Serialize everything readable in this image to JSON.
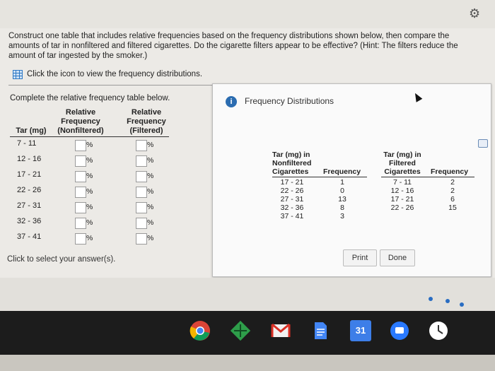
{
  "question": {
    "text": "Construct one table that includes relative frequencies based on the frequency distributions shown below, then compare the amounts of tar in nonfiltered and filtered cigarettes. Do the cigarette filters appear to be effective? (Hint: The filters reduce the amount of tar ingested by the smoker.)",
    "icon_text": "Click the icon to view the frequency distributions."
  },
  "left_table": {
    "instruction": "Complete the relative frequency table below.",
    "col_tar": "Tar (mg)",
    "col_nonfiltered": [
      "Relative",
      "Frequency",
      "(Nonfiltered)"
    ],
    "col_filtered": [
      "Relative",
      "Frequency",
      "(Filtered)"
    ],
    "pct_symbol": "%",
    "rows": [
      "7 - 11",
      "12 - 16",
      "17 - 21",
      "22 - 26",
      "27 - 31",
      "32 - 36",
      "37 - 41"
    ]
  },
  "footer": {
    "select_text": "Click to select your answer(s)."
  },
  "popup": {
    "title": "Frequency Distributions",
    "nonfiltered_header": [
      "Tar (mg) in",
      "Nonfiltered",
      "Cigarettes"
    ],
    "filtered_header": [
      "Tar (mg) in",
      "Filtered",
      "Cigarettes"
    ],
    "freq_header": "Frequency",
    "nonfiltered_classes": [
      "17 - 21",
      "22 - 26",
      "27 - 31",
      "32 - 36",
      "37 - 41"
    ],
    "nonfiltered_freq": [
      "1",
      "0",
      "13",
      "8",
      "3"
    ],
    "filtered_classes": [
      "7 - 11",
      "12 - 16",
      "17 - 21",
      "22 - 26"
    ],
    "filtered_freq": [
      "2",
      "2",
      "6",
      "15"
    ],
    "print_label": "Print",
    "done_label": "Done"
  },
  "taskbar": {
    "calendar_day": "31"
  },
  "colors": {
    "accent": "#2b6cb0",
    "taskbar": "#1c1c1c"
  },
  "icons": [
    "gear-icon",
    "grid-table-icon",
    "info-icon",
    "maximize-icon",
    "chrome-icon",
    "game-icon",
    "gmail-icon",
    "docs-icon",
    "calendar-icon",
    "chat-icon",
    "clock-icon"
  ]
}
